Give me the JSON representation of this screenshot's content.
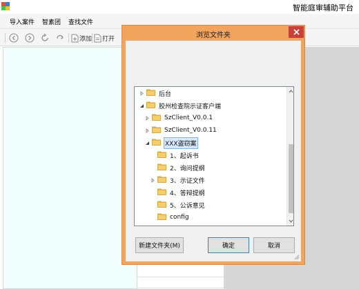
{
  "app": {
    "title": "智能庭审辅助平台"
  },
  "menu": {
    "items": [
      "导入案件",
      "智素团",
      "查找文件"
    ]
  },
  "toolbar": {
    "add_label": "添加",
    "open_label": "打开"
  },
  "dialog": {
    "title": "浏览文件夹",
    "tree": [
      {
        "label": "后台",
        "expander": "collapsed"
      },
      {
        "label": "胶州检查院示证客户端",
        "expander": "expanded"
      },
      {
        "label": "SzClient_V0.0.1",
        "expander": "collapsed"
      },
      {
        "label": "SzClient_V0.0.11",
        "expander": "collapsed"
      },
      {
        "label": "XXX盗窃案",
        "expander": "expanded",
        "selected": true
      },
      {
        "label": "1、起诉书",
        "expander": "none"
      },
      {
        "label": "2、询问提纲",
        "expander": "none"
      },
      {
        "label": "3、示证文件",
        "expander": "collapsed"
      },
      {
        "label": "4、答辩提纲",
        "expander": "none"
      },
      {
        "label": "5、公诉意见",
        "expander": "none"
      },
      {
        "label": "config",
        "expander": "none"
      }
    ],
    "buttons": {
      "new_folder": "新建文件夹(M)",
      "ok": "确定",
      "cancel": "取消"
    }
  },
  "colors": {
    "dialog_frame": "#f1a45d",
    "close_button": "#c7403a",
    "left_panel": "#f0fffe",
    "right_panel": "#d6d6d6",
    "folder": "#e8b84a",
    "selection": "#d7e8fc"
  }
}
